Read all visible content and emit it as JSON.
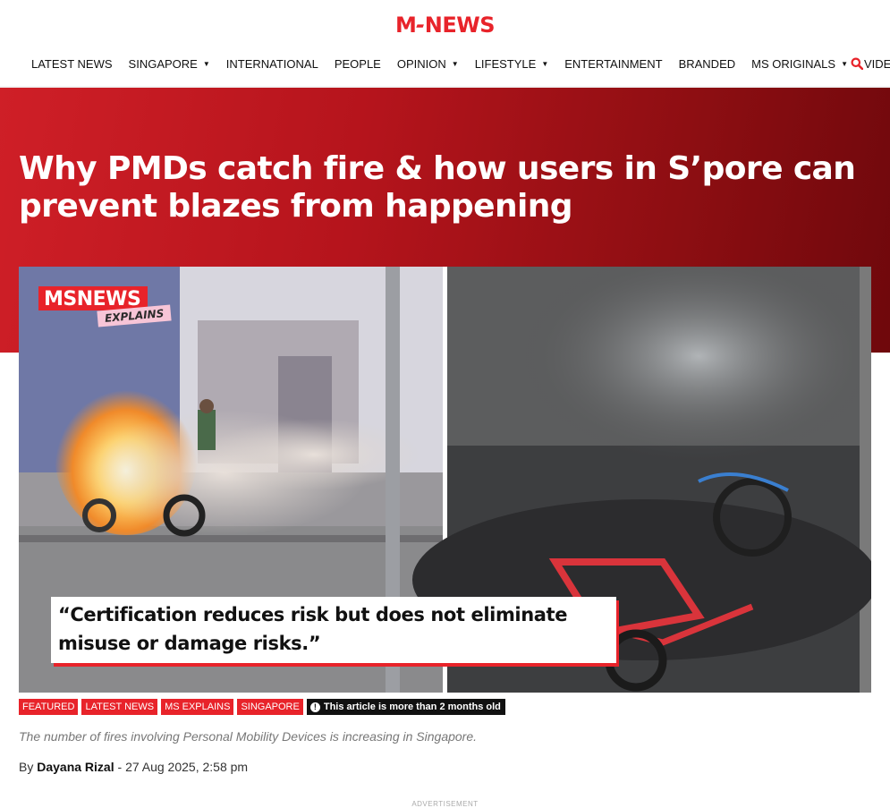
{
  "logo": {
    "left": "M",
    "slash": "-",
    "right": "NEWS"
  },
  "nav": [
    {
      "label": "LATEST NEWS",
      "dropdown": false
    },
    {
      "label": "SINGAPORE",
      "dropdown": true
    },
    {
      "label": "INTERNATIONAL",
      "dropdown": false
    },
    {
      "label": "PEOPLE",
      "dropdown": false
    },
    {
      "label": "OPINION",
      "dropdown": true
    },
    {
      "label": "LIFESTYLE",
      "dropdown": true
    },
    {
      "label": "ENTERTAINMENT",
      "dropdown": false
    },
    {
      "label": "BRANDED",
      "dropdown": false
    },
    {
      "label": "MS ORIGINALS",
      "dropdown": true
    },
    {
      "label": "VIDEOS",
      "dropdown": false
    }
  ],
  "icons": {
    "search": "search-icon",
    "chevron": "chevron-down-icon",
    "info": "info-icon"
  },
  "colors": {
    "brand": "#e8232a",
    "hero_dark": "#6f080c",
    "tag_bg": "#e8232a",
    "age_bg": "#111111"
  },
  "article": {
    "title": "Why PMDs catch fire & how users in S’pore can prevent blazes from happening",
    "image_badge": {
      "news": "MSNEWS",
      "explains": "EXPLAINS"
    },
    "image_quote": "“Certification reduces risk but does not eliminate misuse or damage risks.”",
    "tags": [
      "FEATURED",
      "LATEST NEWS",
      "MS EXPLAINS",
      "SINGAPORE"
    ],
    "age_notice": "This article is more than 2 months old",
    "caption": "The number of fires involving Personal Mobility Devices is increasing in Singapore.",
    "byline_prefix": "By",
    "author": "Dayana Rizal",
    "date_sep": "-",
    "date": "27 Aug 2025, 2:58 pm"
  },
  "ad_label": "ADVERTISEMENT"
}
